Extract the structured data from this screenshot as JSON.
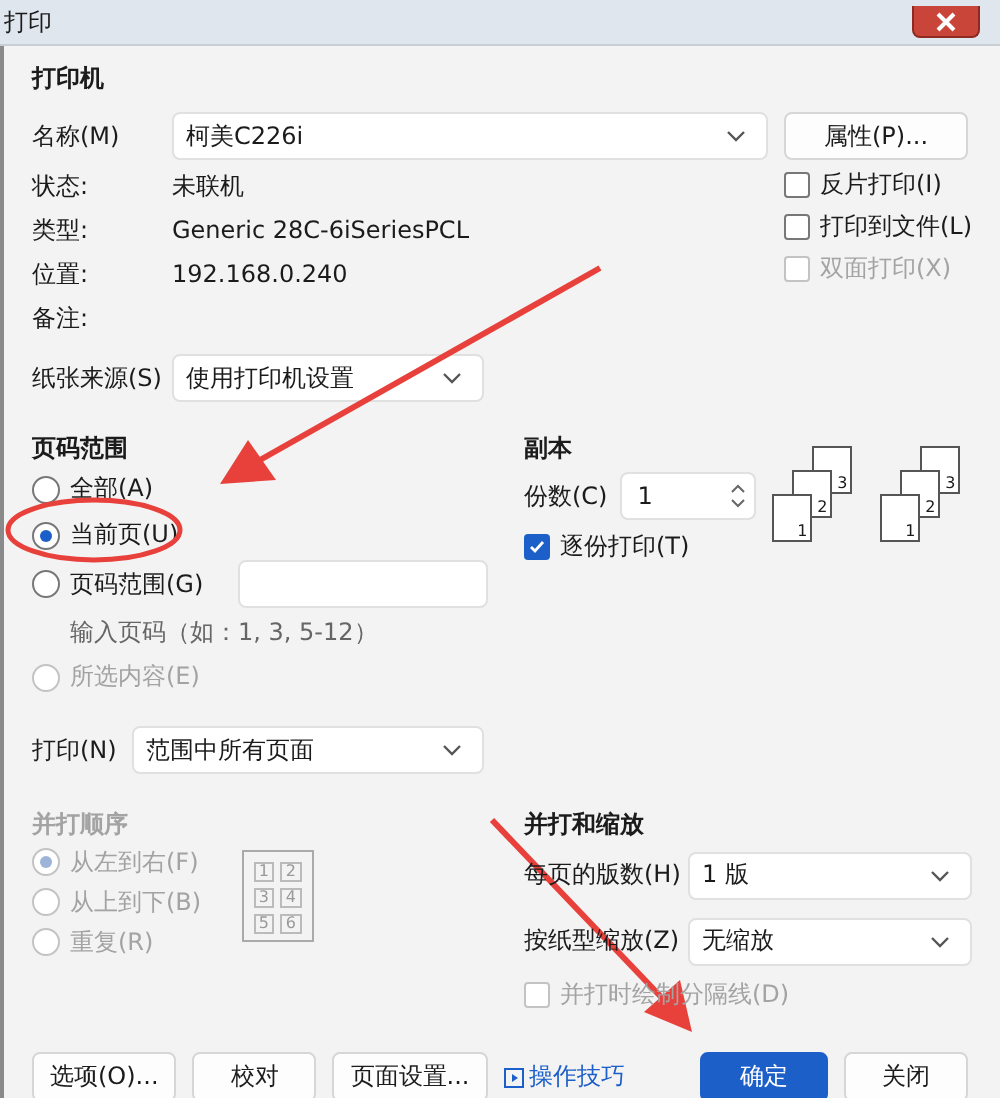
{
  "window": {
    "title": "打印"
  },
  "printer": {
    "heading": "打印机",
    "name_label": "名称(M)",
    "name_value": "柯美C226i",
    "properties_button": "属性(P)...",
    "options": [
      {
        "label": "反片打印(I)",
        "checked": false,
        "disabled": false
      },
      {
        "label": "打印到文件(L)",
        "checked": false,
        "disabled": false
      },
      {
        "label": "双面打印(X)",
        "checked": false,
        "disabled": true
      }
    ],
    "info": [
      {
        "label": "状态:",
        "value": "未联机"
      },
      {
        "label": "类型:",
        "value": "Generic 28C-6iSeriesPCL"
      },
      {
        "label": "位置:",
        "value": "192.168.0.240"
      },
      {
        "label": "备注:"
      }
    ],
    "paper_source": {
      "label": "纸张来源(S)",
      "value": "使用打印机设置"
    }
  },
  "page_range": {
    "heading": "页码范围",
    "options": [
      {
        "label": "全部(A)",
        "selected": false,
        "disabled": false,
        "kind": "plain"
      },
      {
        "label": "当前页(U)",
        "selected": true,
        "disabled": false,
        "kind": "plain"
      },
      {
        "label": "页码范围(G)",
        "selected": false,
        "disabled": false,
        "kind": "field",
        "hint": "输入页码（如：1, 3, 5-12）"
      },
      {
        "label": "所选内容(E)",
        "selected": false,
        "disabled": true,
        "kind": "plain"
      }
    ]
  },
  "print": {
    "label": "打印(N)",
    "value": "范围中所有页面"
  },
  "copies": {
    "heading": "副本",
    "label": "份数(C)",
    "value": "1",
    "collate": {
      "label": "逐份打印(T)",
      "checked": true
    },
    "stacks": [
      {
        "pages": [
          "3",
          "2",
          "1"
        ]
      },
      {
        "pages": [
          "3",
          "2",
          "1"
        ]
      }
    ]
  },
  "order": {
    "heading": "并打顺序",
    "disabled": true,
    "options": [
      {
        "label": "从左到右(F)",
        "selected": true
      },
      {
        "label": "从上到下(B)",
        "selected": false
      },
      {
        "label": "重复(R)",
        "selected": false
      }
    ],
    "preview": [
      "1",
      "2",
      "3",
      "4",
      "5",
      "6"
    ]
  },
  "scaling": {
    "heading": "并打和缩放",
    "rows": [
      {
        "label": "每页的版数(H)",
        "value": "1 版"
      },
      {
        "label": "按纸型缩放(Z)",
        "value": "无缩放"
      }
    ],
    "separator": {
      "label": "并打时绘制分隔线(D)",
      "checked": false,
      "disabled": true
    }
  },
  "buttons": [
    {
      "label": "选项(O)...",
      "kind": "plain"
    },
    {
      "label": "校对",
      "kind": "plain"
    },
    {
      "label": "页面设置...",
      "kind": "plain"
    },
    {
      "label": "操作技巧",
      "kind": "link"
    },
    {
      "label": "确定",
      "kind": "primary"
    },
    {
      "label": "关闭",
      "kind": "plain"
    }
  ]
}
